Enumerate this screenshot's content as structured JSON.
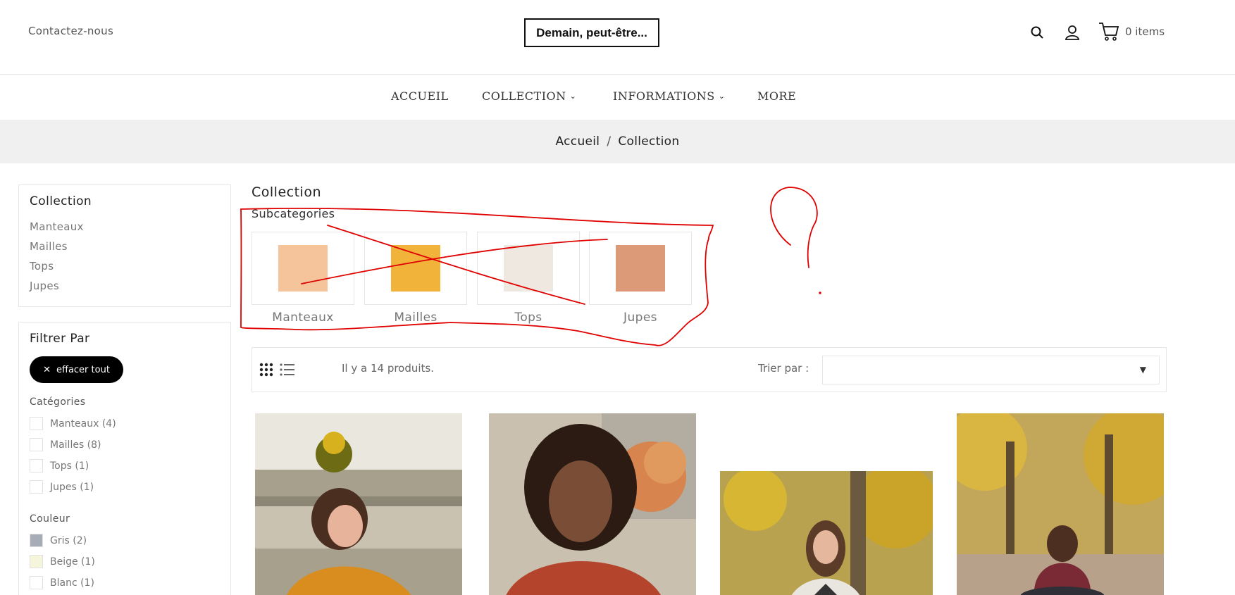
{
  "header": {
    "contact_label": "Contactez-nous",
    "logo_text": "Demain, peut-être...",
    "cart_count": "0 items",
    "icons": [
      "search-icon",
      "user-icon",
      "cart-icon"
    ]
  },
  "nav": {
    "items": [
      {
        "label": "ACCUEIL"
      },
      {
        "label": "COLLECTION"
      },
      {
        "label": "INFORMATIONS"
      },
      {
        "label": "MORE"
      }
    ]
  },
  "breadcrumb": {
    "home": "Accueil",
    "separator": "/",
    "current": "Collection"
  },
  "sidebar": {
    "collection_title": "Collection",
    "links": [
      "Manteaux",
      "Mailles",
      "Tops",
      "Jupes"
    ],
    "filter_title": "Filtrer Par",
    "clear_label": "effacer tout",
    "categories_title": "Catégories",
    "categories": [
      "Manteaux (4)",
      "Mailles (8)",
      "Tops (1)",
      "Jupes (1)"
    ],
    "color_title": "Couleur",
    "colors": [
      {
        "label": "Gris (2)",
        "swatch": "#a7adb7"
      },
      {
        "label": "Beige (1)",
        "swatch": "#f5f5dc"
      },
      {
        "label": "Blanc (1)",
        "swatch": "#ffffff"
      }
    ]
  },
  "main": {
    "title": "Collection",
    "subcategories_title": "Subcategories",
    "subcategories": [
      {
        "label": "Manteaux",
        "color": "#f6c49a"
      },
      {
        "label": "Mailles",
        "color": "#f2b33a"
      },
      {
        "label": "Tops",
        "color": "#efe8e0"
      },
      {
        "label": "Jupes",
        "color": "#dc9a78"
      }
    ],
    "product_count": "Il y a 14 produits.",
    "sort_label": "Trier par :",
    "sort_value": ""
  },
  "colors": {
    "accent": "#000000",
    "annotation": "#e00000",
    "breadcrumb_bg": "#f0f0f0"
  }
}
